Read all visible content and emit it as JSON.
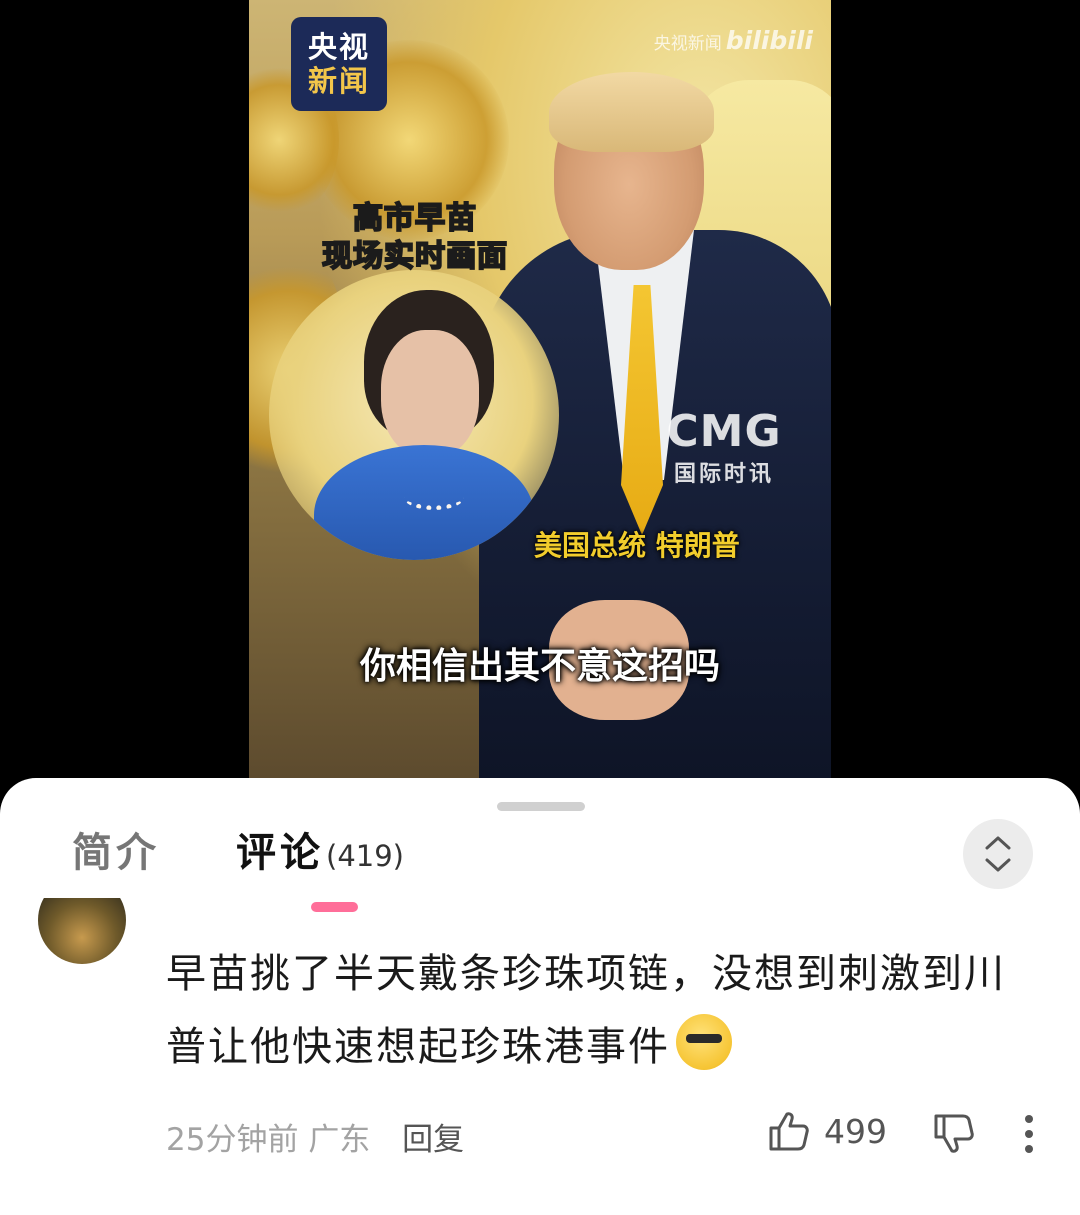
{
  "video": {
    "logo_line1": "央视",
    "logo_line2": "新闻",
    "watermark_text": "央视新闻",
    "watermark_brand": "bilibili",
    "caption_top_line1": "高市早苗",
    "caption_top_line2": "现场实时画面",
    "cmg_big": "CMG",
    "cmg_small": "国际时讯",
    "name_caption": "美国总统 特朗普",
    "subtitle": "你相信出其不意这招吗"
  },
  "tabs": {
    "intro_label": "简介",
    "comments_label": "评论",
    "comments_count": "(419)"
  },
  "comment": {
    "text": "早苗挑了半天戴条珍珠项链，没想到刺激到川普让他快速想起珍珠港事件",
    "emoji": "emoji-sunglasses-face",
    "time": "25分钟前",
    "location": "广东",
    "reply_label": "回复",
    "likes": "499"
  },
  "colors": {
    "tab_indicator": "#ff6e99",
    "caption_yellow": "#f2cd2c",
    "logo_bg": "#1c2a58"
  }
}
